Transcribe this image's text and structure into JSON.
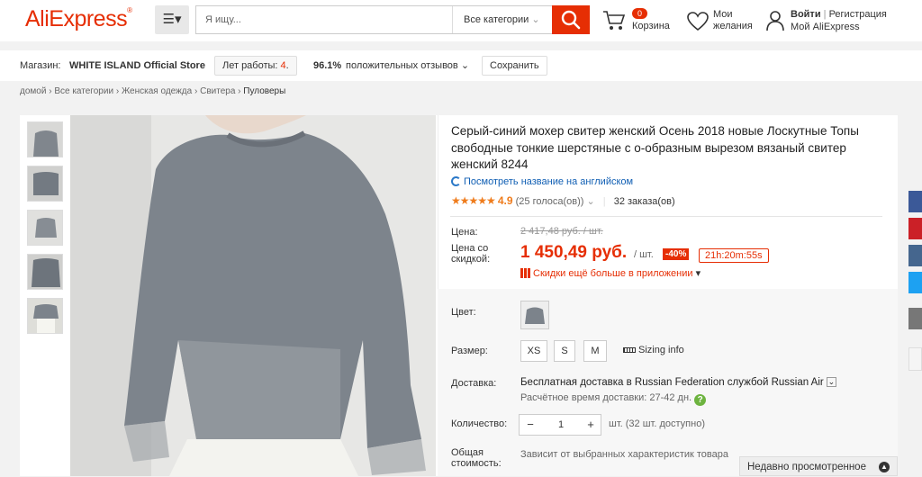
{
  "header": {
    "logo": "AliExpress",
    "logo_mark": "®",
    "search_placeholder": "Я ищу...",
    "category": "Все категории",
    "cart_count": "0",
    "cart_label": "Корзина",
    "wish_line1": "Мои",
    "wish_line2": "желания",
    "login": "Войти",
    "separator": "|",
    "register": "Регистрация",
    "my_account": "Мой AliExpress"
  },
  "store": {
    "label": "Магазин:",
    "name": "WHITE ISLAND Official Store",
    "years_label": "Лет работы:",
    "years_value": "4",
    "years_suffix": ".",
    "feedback_pct": "96.1%",
    "feedback_label": "положительных отзывов",
    "save": "Сохранить"
  },
  "breadcrumb": [
    "домой",
    "Все категории",
    "Женская одежда",
    "Свитера",
    "Пуловеры"
  ],
  "breadcrumb_sep": "›",
  "product": {
    "title": "Серый-синий мохер свитер женский Осень 2018 новые Лоскутные Топы свободные тонкие шерстяные с о-образным вырезом вязаный свитер женский 8244",
    "translate_link": "Посмотреть название на английском",
    "stars": "★★★★★",
    "rating": "4.9",
    "votes": "(25 голоса(ов))",
    "orders": "32 заказа(ов)",
    "price_label": "Цена:",
    "old_price": "2 417,48 руб. / шт.",
    "discount_label": "Цена со скидкой:",
    "new_price": "1 450,49 руб.",
    "unit": "/ шт.",
    "discount": "-40%",
    "timer": "21h:20m:55s",
    "app_promo": "Скидки ещё больше в приложении",
    "color_label": "Цвет:",
    "size_label": "Размер:",
    "sizes": [
      "XS",
      "S",
      "M"
    ],
    "sizing_info": "Sizing info",
    "shipping_label": "Доставка:",
    "shipping": "Бесплатная доставка в Russian Federation службой Russian Air",
    "delivery_time": "Расчётное время доставки: 27-42 дн.",
    "qty_label": "Количество:",
    "qty": "1",
    "qty_minus": "−",
    "qty_plus": "+",
    "qty_note": "шт. (32 шт. доступно)",
    "total_label_1": "Общая",
    "total_label_2": "стоимость:",
    "total_value": "Зависит от выбранных характеристик товара"
  },
  "recently_viewed": "Недавно просмотренное",
  "colors": {
    "brand": "#e62e04",
    "link": "#0f5eb3",
    "star": "#ef7c1c"
  }
}
